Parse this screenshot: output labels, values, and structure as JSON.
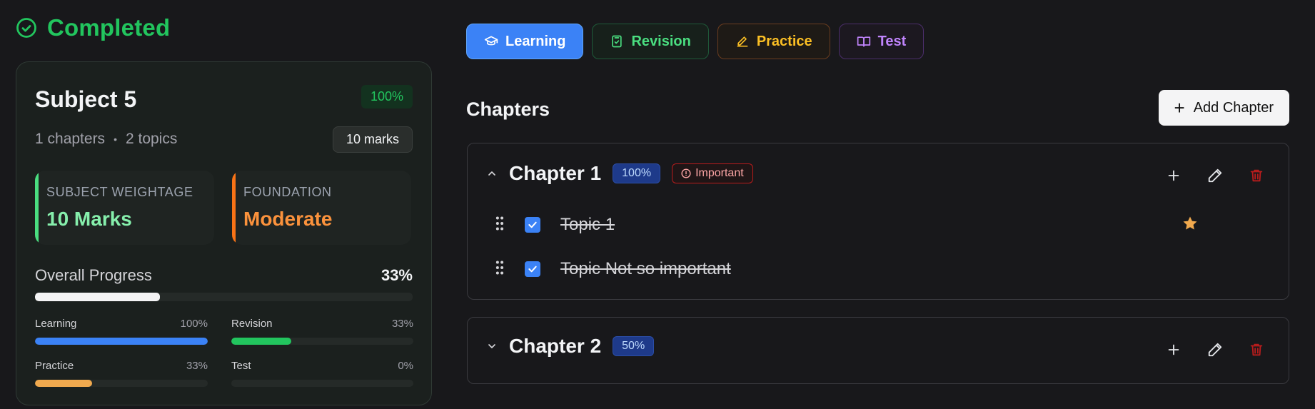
{
  "status": {
    "label": "Completed",
    "color": "#22c55e"
  },
  "subject": {
    "title": "Subject 5",
    "percent": "100%",
    "chapters": "1 chapters",
    "topics": "2 topics",
    "dot": "•",
    "marks": "10 marks",
    "weightage": {
      "label": "SUBJECT WEIGHTAGE",
      "value": "10 Marks"
    },
    "foundation": {
      "label": "FOUNDATION",
      "value": "Moderate"
    },
    "overall": {
      "label": "Overall Progress",
      "percent": "33%",
      "value": 0.33
    },
    "progress": [
      {
        "label": "Learning",
        "percent": "100%",
        "value": 1.0,
        "color": "#3b82f6"
      },
      {
        "label": "Revision",
        "percent": "33%",
        "value": 0.33,
        "color": "#22c55e"
      },
      {
        "label": "Practice",
        "percent": "33%",
        "value": 0.33,
        "color": "#f0a94e"
      },
      {
        "label": "Test",
        "percent": "0%",
        "value": 0.0,
        "color": "#a855f7"
      }
    ]
  },
  "tabs": [
    {
      "label": "Learning",
      "icon": "graduation-cap-icon",
      "active": true
    },
    {
      "label": "Revision",
      "icon": "clipboard-check-icon",
      "active": false
    },
    {
      "label": "Practice",
      "icon": "pencil-icon",
      "active": false
    },
    {
      "label": "Test",
      "icon": "book-open-icon",
      "active": false
    }
  ],
  "chapters_header": {
    "title": "Chapters",
    "add_label": "Add Chapter",
    "add_icon": "plus-icon"
  },
  "chapters": [
    {
      "title": "Chapter 1",
      "percent": "100%",
      "important_label": "Important",
      "expanded": true,
      "topics": [
        {
          "label": "Topic 1",
          "done": true,
          "starred": true
        },
        {
          "label": "Topic Not so important",
          "done": true,
          "starred": false
        }
      ]
    },
    {
      "title": "Chapter 2",
      "percent": "50%",
      "expanded": false
    }
  ]
}
